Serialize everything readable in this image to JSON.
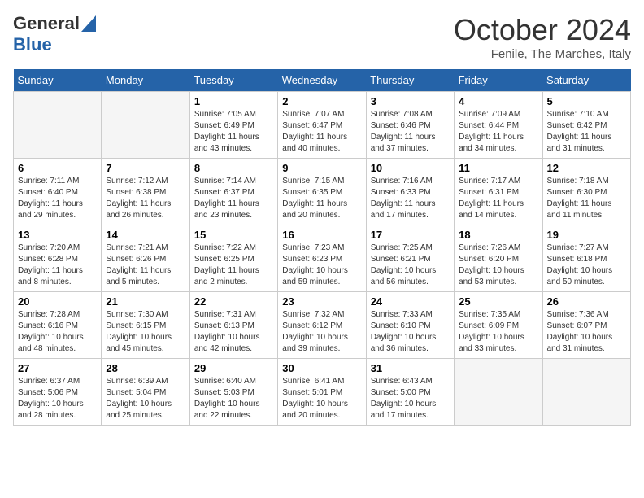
{
  "header": {
    "logo_line1": "General",
    "logo_line2": "Blue",
    "month": "October 2024",
    "location": "Fenile, The Marches, Italy"
  },
  "days_of_week": [
    "Sunday",
    "Monday",
    "Tuesday",
    "Wednesday",
    "Thursday",
    "Friday",
    "Saturday"
  ],
  "weeks": [
    [
      {
        "day": "",
        "empty": true
      },
      {
        "day": "",
        "empty": true
      },
      {
        "day": "1",
        "sunrise": "Sunrise: 7:05 AM",
        "sunset": "Sunset: 6:49 PM",
        "daylight": "Daylight: 11 hours and 43 minutes."
      },
      {
        "day": "2",
        "sunrise": "Sunrise: 7:07 AM",
        "sunset": "Sunset: 6:47 PM",
        "daylight": "Daylight: 11 hours and 40 minutes."
      },
      {
        "day": "3",
        "sunrise": "Sunrise: 7:08 AM",
        "sunset": "Sunset: 6:46 PM",
        "daylight": "Daylight: 11 hours and 37 minutes."
      },
      {
        "day": "4",
        "sunrise": "Sunrise: 7:09 AM",
        "sunset": "Sunset: 6:44 PM",
        "daylight": "Daylight: 11 hours and 34 minutes."
      },
      {
        "day": "5",
        "sunrise": "Sunrise: 7:10 AM",
        "sunset": "Sunset: 6:42 PM",
        "daylight": "Daylight: 11 hours and 31 minutes."
      }
    ],
    [
      {
        "day": "6",
        "sunrise": "Sunrise: 7:11 AM",
        "sunset": "Sunset: 6:40 PM",
        "daylight": "Daylight: 11 hours and 29 minutes."
      },
      {
        "day": "7",
        "sunrise": "Sunrise: 7:12 AM",
        "sunset": "Sunset: 6:38 PM",
        "daylight": "Daylight: 11 hours and 26 minutes."
      },
      {
        "day": "8",
        "sunrise": "Sunrise: 7:14 AM",
        "sunset": "Sunset: 6:37 PM",
        "daylight": "Daylight: 11 hours and 23 minutes."
      },
      {
        "day": "9",
        "sunrise": "Sunrise: 7:15 AM",
        "sunset": "Sunset: 6:35 PM",
        "daylight": "Daylight: 11 hours and 20 minutes."
      },
      {
        "day": "10",
        "sunrise": "Sunrise: 7:16 AM",
        "sunset": "Sunset: 6:33 PM",
        "daylight": "Daylight: 11 hours and 17 minutes."
      },
      {
        "day": "11",
        "sunrise": "Sunrise: 7:17 AM",
        "sunset": "Sunset: 6:31 PM",
        "daylight": "Daylight: 11 hours and 14 minutes."
      },
      {
        "day": "12",
        "sunrise": "Sunrise: 7:18 AM",
        "sunset": "Sunset: 6:30 PM",
        "daylight": "Daylight: 11 hours and 11 minutes."
      }
    ],
    [
      {
        "day": "13",
        "sunrise": "Sunrise: 7:20 AM",
        "sunset": "Sunset: 6:28 PM",
        "daylight": "Daylight: 11 hours and 8 minutes."
      },
      {
        "day": "14",
        "sunrise": "Sunrise: 7:21 AM",
        "sunset": "Sunset: 6:26 PM",
        "daylight": "Daylight: 11 hours and 5 minutes."
      },
      {
        "day": "15",
        "sunrise": "Sunrise: 7:22 AM",
        "sunset": "Sunset: 6:25 PM",
        "daylight": "Daylight: 11 hours and 2 minutes."
      },
      {
        "day": "16",
        "sunrise": "Sunrise: 7:23 AM",
        "sunset": "Sunset: 6:23 PM",
        "daylight": "Daylight: 10 hours and 59 minutes."
      },
      {
        "day": "17",
        "sunrise": "Sunrise: 7:25 AM",
        "sunset": "Sunset: 6:21 PM",
        "daylight": "Daylight: 10 hours and 56 minutes."
      },
      {
        "day": "18",
        "sunrise": "Sunrise: 7:26 AM",
        "sunset": "Sunset: 6:20 PM",
        "daylight": "Daylight: 10 hours and 53 minutes."
      },
      {
        "day": "19",
        "sunrise": "Sunrise: 7:27 AM",
        "sunset": "Sunset: 6:18 PM",
        "daylight": "Daylight: 10 hours and 50 minutes."
      }
    ],
    [
      {
        "day": "20",
        "sunrise": "Sunrise: 7:28 AM",
        "sunset": "Sunset: 6:16 PM",
        "daylight": "Daylight: 10 hours and 48 minutes."
      },
      {
        "day": "21",
        "sunrise": "Sunrise: 7:30 AM",
        "sunset": "Sunset: 6:15 PM",
        "daylight": "Daylight: 10 hours and 45 minutes."
      },
      {
        "day": "22",
        "sunrise": "Sunrise: 7:31 AM",
        "sunset": "Sunset: 6:13 PM",
        "daylight": "Daylight: 10 hours and 42 minutes."
      },
      {
        "day": "23",
        "sunrise": "Sunrise: 7:32 AM",
        "sunset": "Sunset: 6:12 PM",
        "daylight": "Daylight: 10 hours and 39 minutes."
      },
      {
        "day": "24",
        "sunrise": "Sunrise: 7:33 AM",
        "sunset": "Sunset: 6:10 PM",
        "daylight": "Daylight: 10 hours and 36 minutes."
      },
      {
        "day": "25",
        "sunrise": "Sunrise: 7:35 AM",
        "sunset": "Sunset: 6:09 PM",
        "daylight": "Daylight: 10 hours and 33 minutes."
      },
      {
        "day": "26",
        "sunrise": "Sunrise: 7:36 AM",
        "sunset": "Sunset: 6:07 PM",
        "daylight": "Daylight: 10 hours and 31 minutes."
      }
    ],
    [
      {
        "day": "27",
        "sunrise": "Sunrise: 6:37 AM",
        "sunset": "Sunset: 5:06 PM",
        "daylight": "Daylight: 10 hours and 28 minutes."
      },
      {
        "day": "28",
        "sunrise": "Sunrise: 6:39 AM",
        "sunset": "Sunset: 5:04 PM",
        "daylight": "Daylight: 10 hours and 25 minutes."
      },
      {
        "day": "29",
        "sunrise": "Sunrise: 6:40 AM",
        "sunset": "Sunset: 5:03 PM",
        "daylight": "Daylight: 10 hours and 22 minutes."
      },
      {
        "day": "30",
        "sunrise": "Sunrise: 6:41 AM",
        "sunset": "Sunset: 5:01 PM",
        "daylight": "Daylight: 10 hours and 20 minutes."
      },
      {
        "day": "31",
        "sunrise": "Sunrise: 6:43 AM",
        "sunset": "Sunset: 5:00 PM",
        "daylight": "Daylight: 10 hours and 17 minutes."
      },
      {
        "day": "",
        "empty": true
      },
      {
        "day": "",
        "empty": true
      }
    ]
  ]
}
